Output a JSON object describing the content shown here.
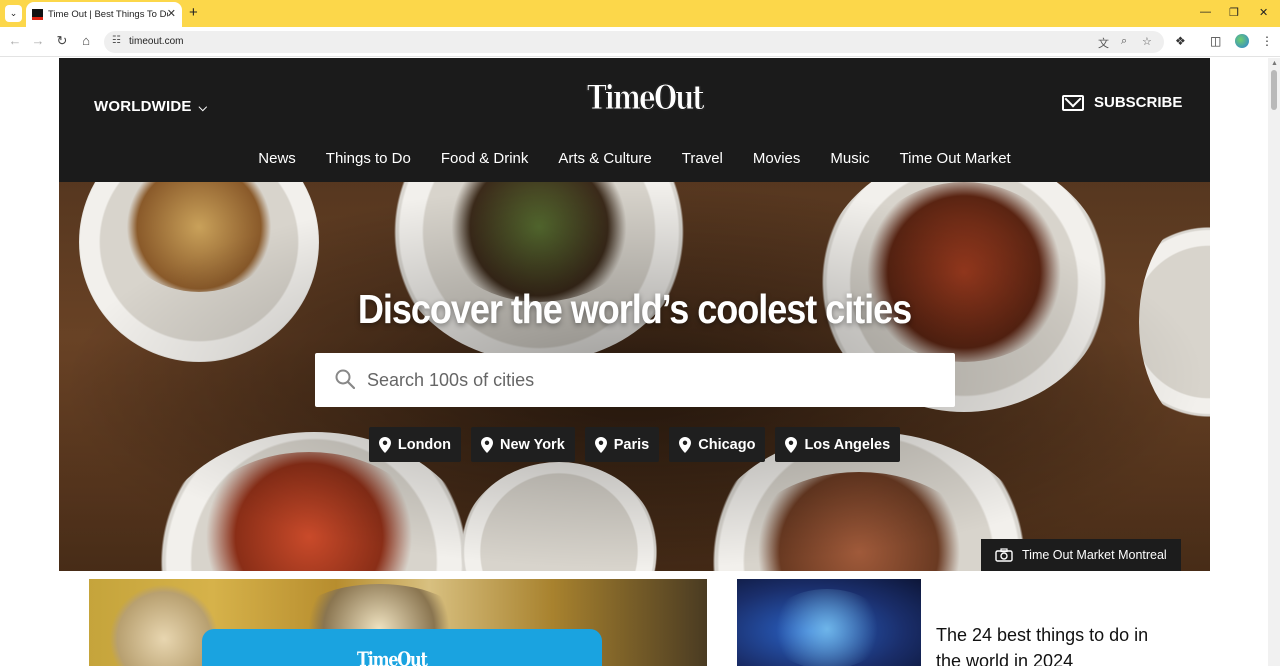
{
  "browser": {
    "tab_title": "Time Out | Best Things To Do",
    "url": "timeout.com",
    "tab_search_icon": "chevron-down-icon",
    "new_tab_icon": "plus-icon"
  },
  "header": {
    "region": "WORLDWIDE",
    "logo": "TimeOut",
    "subscribe": "SUBSCRIBE",
    "nav": [
      "News",
      "Things to Do",
      "Food & Drink",
      "Arts & Culture",
      "Travel",
      "Movies",
      "Music",
      "Time Out Market"
    ]
  },
  "hero": {
    "title": "Discover the world’s coolest cities",
    "search_placeholder": "Search 100s of cities",
    "cities": [
      "London",
      "New York",
      "Paris",
      "Chicago",
      "Los Angeles"
    ],
    "photo_credit": "Time Out Market Montreal"
  },
  "feature": {
    "card_logo": "TimeOut"
  },
  "article": {
    "title": "The 24 best things to do in the world in 2024"
  },
  "colors": {
    "tab_strip": "#fcd74a",
    "header_bg": "#1b1b1b",
    "chip_bg": "#1f1f1f"
  }
}
